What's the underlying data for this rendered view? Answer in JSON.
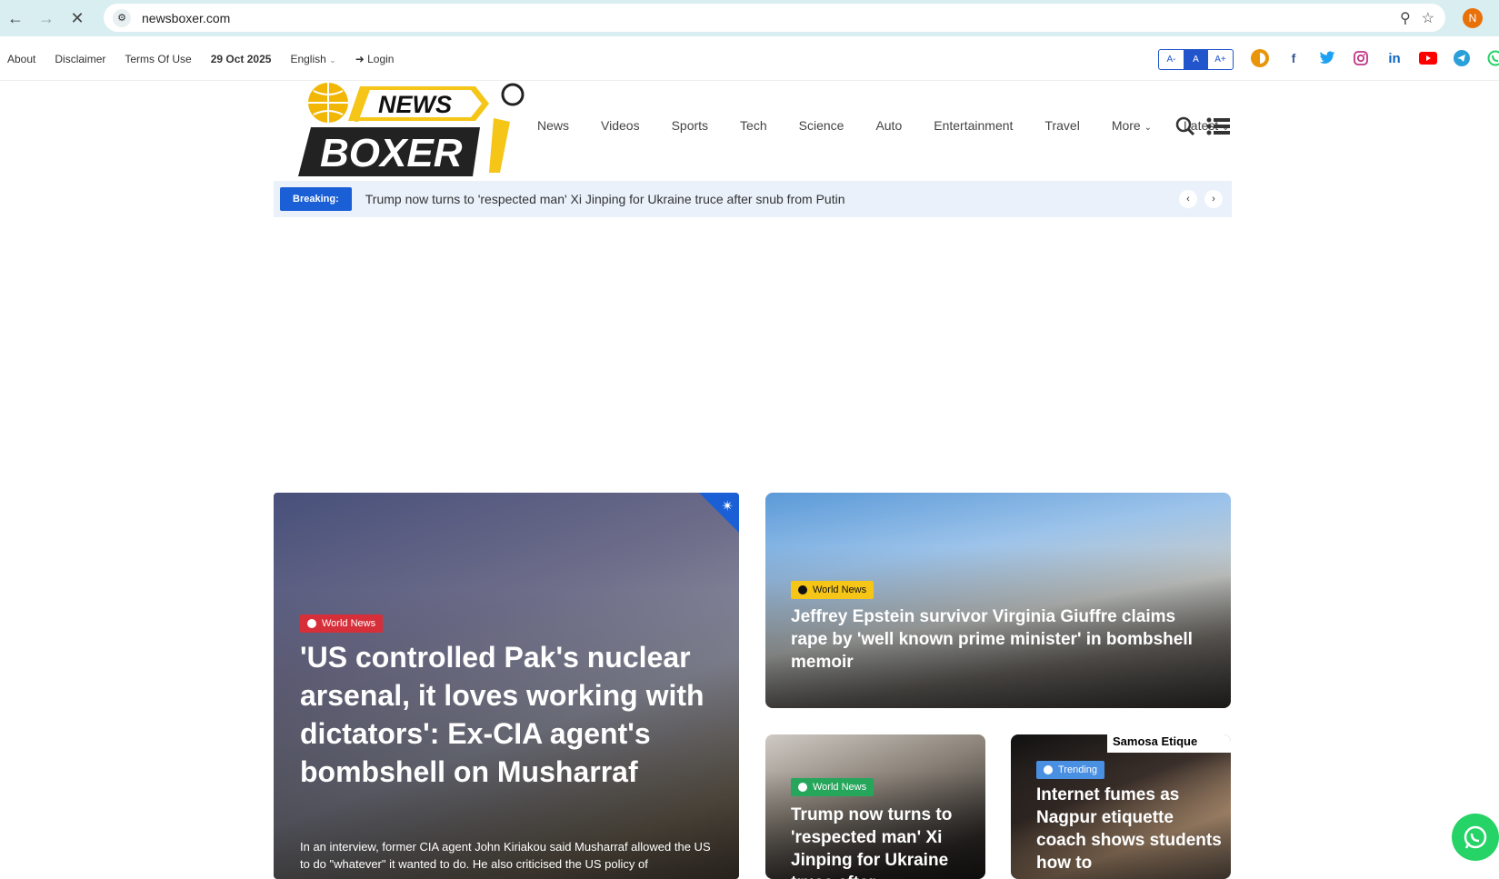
{
  "browser": {
    "url": "newsboxer.com",
    "profile_initial": "N"
  },
  "topbar": {
    "links": [
      "About",
      "Disclaimer",
      "Terms Of Use"
    ],
    "date": "29 Oct 2025",
    "language": "English",
    "login": "Login",
    "font_sizes": [
      "A-",
      "A",
      "A+"
    ],
    "socials": [
      "dark-mode-icon",
      "facebook-icon",
      "twitter-icon",
      "instagram-icon",
      "linkedin-icon",
      "youtube-icon",
      "telegram-icon",
      "whatsapp-icon"
    ]
  },
  "logo": {
    "line1": "NEWS",
    "line2": "BOXER"
  },
  "nav": {
    "items": [
      "News",
      "Videos",
      "Sports",
      "Tech",
      "Science",
      "Auto",
      "Entertainment",
      "Travel",
      "More",
      "Latest"
    ]
  },
  "breaking": {
    "label": "Breaking:",
    "text": "Trump now turns to 'respected man' Xi Jinping for Ukraine truce after snub from Putin"
  },
  "cards": [
    {
      "category": "World News",
      "title": "'US controlled Pak's nuclear arsenal, it loves working with dictators': Ex-CIA agent's bombshell on Musharraf",
      "excerpt": "In an interview, former CIA agent John Kiriakou said Musharraf allowed the US to do \"whatever\" it wanted to do. He also criticised the US policy of"
    },
    {
      "category": "World News",
      "title": "Jeffrey Epstein survivor Virginia Giuffre claims rape by 'well known prime minister' in bombshell memoir"
    },
    {
      "category": "World News",
      "title": "Trump now turns to 'respected man' Xi Jinping for Ukraine truce after"
    },
    {
      "category": "Trending",
      "title": "Internet fumes as Nagpur etiquette coach shows students how to",
      "image_caption": "Samosa Etique"
    }
  ],
  "colors": {
    "accent": "#1a5fd6",
    "breaking_bg": "#eaf1fb",
    "red_tag": "#d62f3a",
    "yellow_tag": "#f5c518",
    "green_tag": "#26a65b",
    "blue_tag": "#4a90e2"
  }
}
